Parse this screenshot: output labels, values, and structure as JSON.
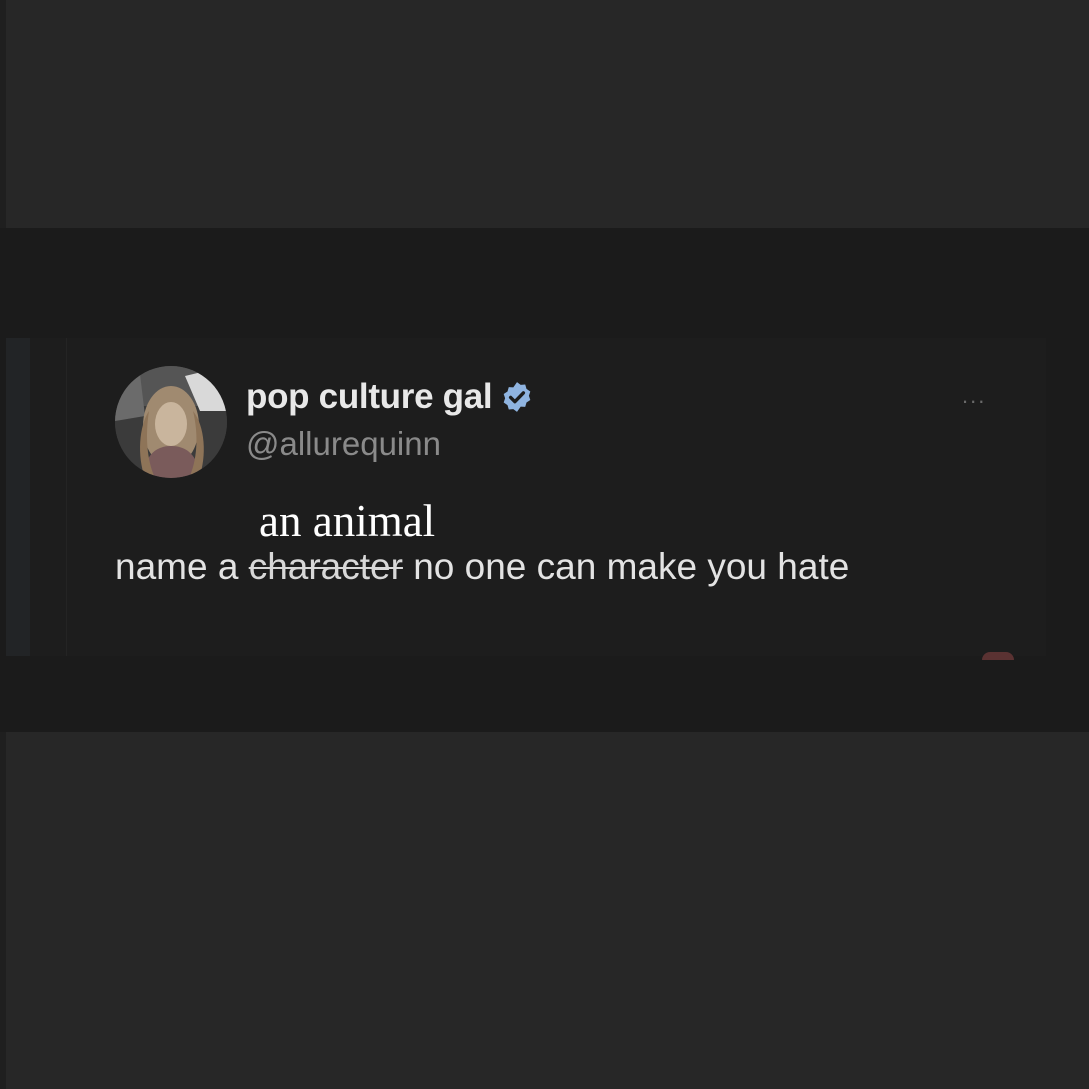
{
  "post": {
    "display_name": "pop culture gal",
    "handle": "@allurequinn",
    "verified": true,
    "more_label": "...",
    "text_prefix": "name a ",
    "text_struck": "character",
    "text_suffix": " no one can make you hate",
    "overlay_replacement": "an animal"
  },
  "icons": {
    "avatar": "avatar-photo",
    "verified": "verified-badge-icon",
    "more": "more-options-icon"
  },
  "colors": {
    "background": "#272727",
    "card": "#1d1d1d",
    "verified_badge": "#8fb4e0",
    "text": "#e3e3e3",
    "handle": "#8a8a8a"
  }
}
